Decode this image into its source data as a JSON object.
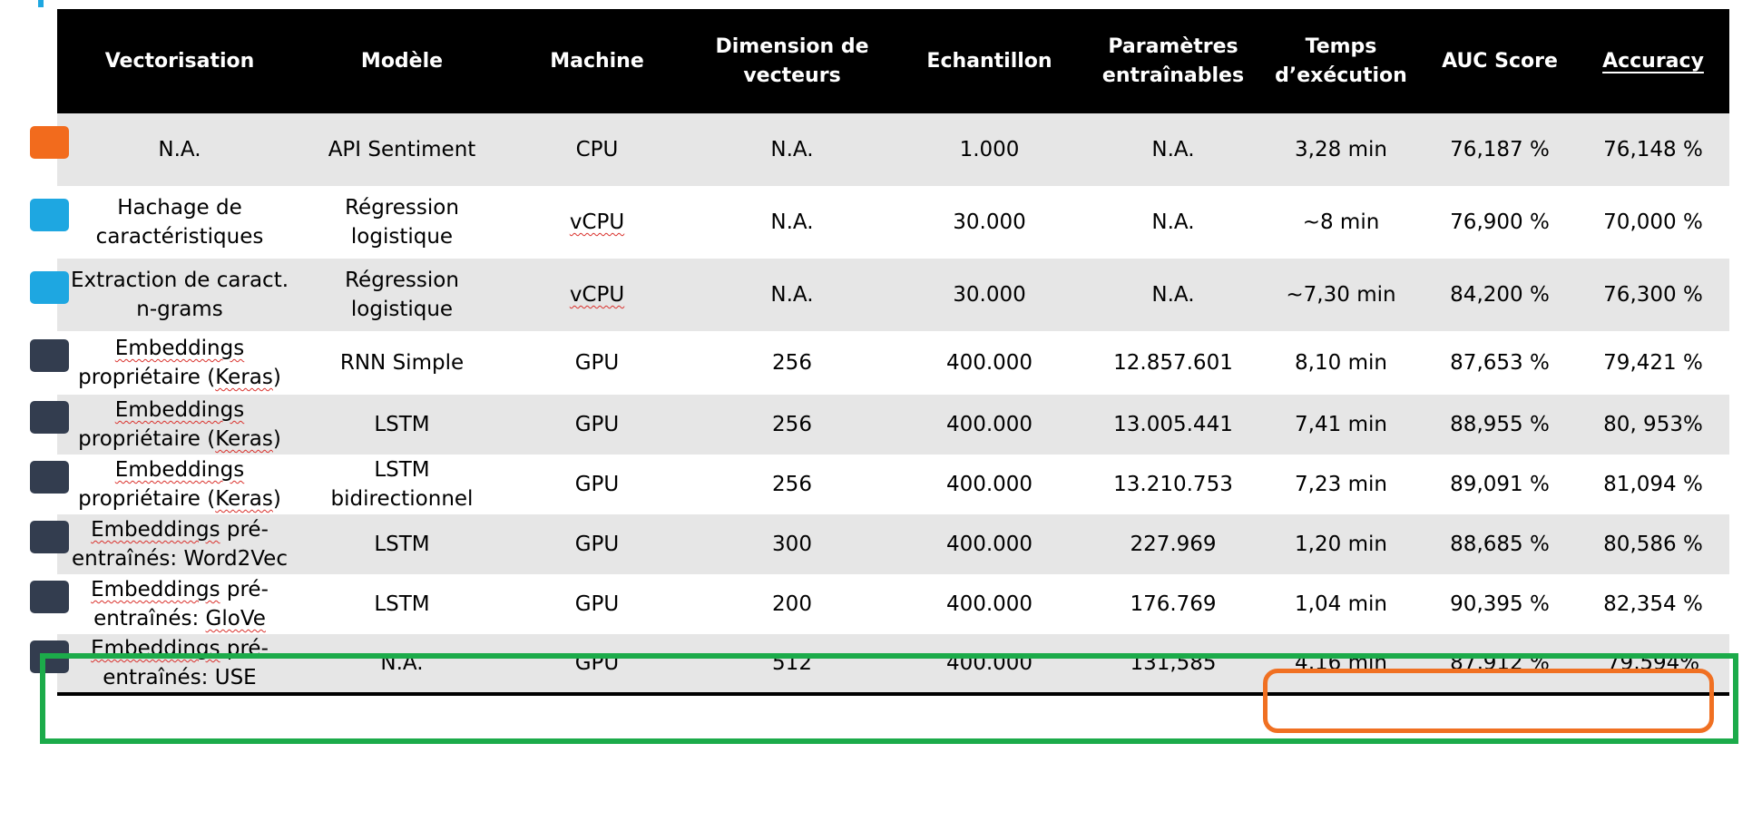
{
  "headers": [
    "Vectorisation",
    "Modèle",
    "Machine",
    "Dimension de vecteurs",
    "Echantillon",
    "Paramètres entraînables",
    "Temps d’exécution",
    "AUC Score",
    "Accuracy"
  ],
  "rows": [
    {
      "swatch_color": "#f26b1d",
      "vectorisation": "N.A.",
      "modele": "API Sentiment",
      "machine": "CPU",
      "dimension": "N.A.",
      "echantillon": "1.000",
      "parametres": "N.A.",
      "temps": "3,28 min",
      "auc": "76,187 %",
      "accuracy": "76,148 %"
    },
    {
      "swatch_color": "#1ea7e1",
      "vectorisation": "Hachage de caractéristiques",
      "modele": "Régression logistique",
      "machine": "vCPU",
      "dimension": "N.A.",
      "echantillon": "30.000",
      "parametres": "N.A.",
      "temps": "~8 min",
      "auc": "76,900 %",
      "accuracy": "70,000 %"
    },
    {
      "swatch_color": "#1ea7e1",
      "vectorisation": "Extraction de caract. n-grams",
      "modele": "Régression logistique",
      "machine": "vCPU",
      "dimension": "N.A.",
      "echantillon": "30.000",
      "parametres": "N.A.",
      "temps": "~7,30 min",
      "auc": "84,200 %",
      "accuracy": "76,300 %"
    },
    {
      "swatch_color": "#333d4f",
      "vectorisation": "Embeddings propriétaire (Keras)",
      "modele": "RNN Simple",
      "machine": "GPU",
      "dimension": "256",
      "echantillon": "400.000",
      "parametres": "12.857.601",
      "temps": "8,10 min",
      "auc": "87,653 %",
      "accuracy": "79,421 %"
    },
    {
      "swatch_color": "#333d4f",
      "vectorisation": "Embeddings propriétaire (Keras)",
      "modele": "LSTM",
      "machine": "GPU",
      "dimension": "256",
      "echantillon": "400.000",
      "parametres": "13.005.441",
      "temps": "7,41 min",
      "auc": "88,955 %",
      "accuracy": "80, 953%"
    },
    {
      "swatch_color": "#333d4f",
      "vectorisation": "Embeddings propriétaire (Keras)",
      "modele": "LSTM bidirectionnel",
      "machine": "GPU",
      "dimension": "256",
      "echantillon": "400.000",
      "parametres": "13.210.753",
      "temps": "7,23 min",
      "auc": "89,091 %",
      "accuracy": "81,094 %"
    },
    {
      "swatch_color": "#333d4f",
      "vectorisation": "Embeddings pré-entraînés: Word2Vec",
      "modele": "LSTM",
      "machine": "GPU",
      "dimension": "300",
      "echantillon": "400.000",
      "parametres": "227.969",
      "temps": "1,20 min",
      "auc": "88,685 %",
      "accuracy": "80,586 %"
    },
    {
      "swatch_color": "#333d4f",
      "vectorisation": "Embeddings pré-entraînés: GloVe",
      "modele": "LSTM",
      "machine": "GPU",
      "dimension": "200",
      "echantillon": "400.000",
      "parametres": "176.769",
      "temps": "1,04 min",
      "auc": "90,395 %",
      "accuracy": "82,354 %"
    },
    {
      "swatch_color": "#333d4f",
      "vectorisation": "Embeddings pré-entraînés: USE",
      "modele": "N.A.",
      "machine": "GPU",
      "dimension": "512",
      "echantillon": "400.000",
      "parametres": "131,585",
      "temps": "4,16 min",
      "auc": "87,912 %",
      "accuracy": "79,594%"
    }
  ],
  "highlight_colors": {
    "best_row": "#1cab4a",
    "best_metrics": "#f07022"
  }
}
